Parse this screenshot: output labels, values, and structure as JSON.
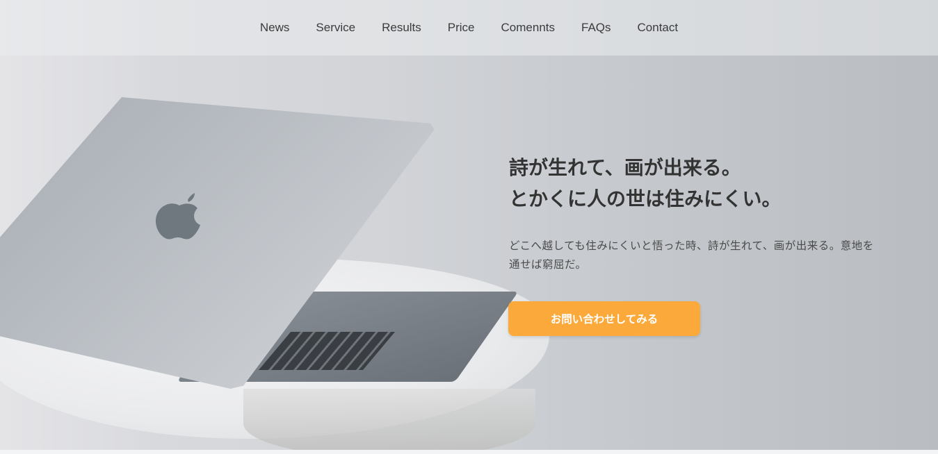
{
  "nav": {
    "items": [
      {
        "label": "News"
      },
      {
        "label": "Service"
      },
      {
        "label": "Results"
      },
      {
        "label": "Price"
      },
      {
        "label": "Comennts"
      },
      {
        "label": "FAQs"
      },
      {
        "label": "Contact"
      }
    ]
  },
  "hero": {
    "heading_line1": "詩が生れて、画が出来る。",
    "heading_line2": "とかくに人の世は住みにくい。",
    "body": "どこへ越しても住みにくいと悟った時、詩が生れて、画が出来る。意地を通せば窮屈だ。",
    "cta_label": "お問い合わせしてみる"
  },
  "colors": {
    "accent": "#fba93a",
    "heading": "#333333",
    "nav_text": "#3b3b3b"
  },
  "icons": {
    "logo_on_laptop": "apple-logo-icon"
  }
}
